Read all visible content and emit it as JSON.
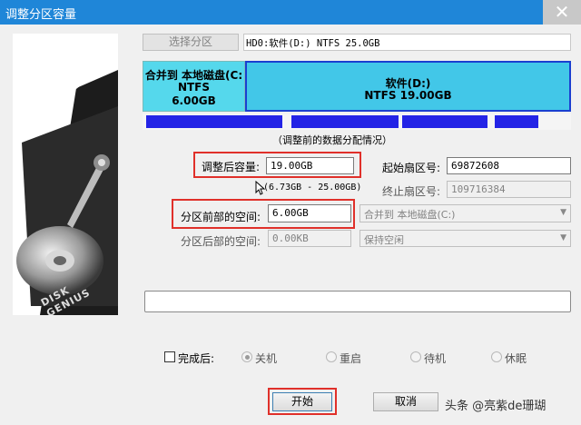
{
  "window": {
    "title": "调整分区容量",
    "close_glyph": "✕"
  },
  "top": {
    "select_partition_button": "选择分区",
    "disk_info": "HD0:软件(D:) NTFS 25.0GB"
  },
  "partitions": [
    {
      "line1": "合并到 本地磁盘(C:",
      "line2": "NTFS",
      "line3": "6.00GB",
      "fraction": 0.24,
      "color": "#55d8ec",
      "selected": false
    },
    {
      "line1": "软件(D:)",
      "line2": "NTFS 19.00GB",
      "line3": "",
      "fraction": 0.76,
      "color": "#42c7e8",
      "selected": true
    }
  ],
  "usage_caption": "（调整前的数据分配情况）",
  "fields": {
    "new_size_label": "调整后容量:",
    "new_size_value": "19.00GB",
    "range_hint": "(6.73GB - 25.00GB)",
    "start_sector_label": "起始扇区号:",
    "start_sector_value": "69872608",
    "end_sector_label": "终止扇区号:",
    "end_sector_value": "109716384",
    "space_before_label": "分区前部的空间:",
    "space_before_value": "6.00GB",
    "space_before_action": "合并到 本地磁盘(C:)",
    "space_after_label": "分区后部的空间:",
    "space_after_value": "0.00KB",
    "space_after_action": "保持空闲"
  },
  "after_completion": {
    "checkbox_label": "完成后:",
    "checked": false,
    "options": [
      "关机",
      "重启",
      "待机",
      "休眠"
    ],
    "selected_index": 0
  },
  "buttons": {
    "start": "开始",
    "cancel": "取消"
  },
  "left_image_text": "DISK GENIUS",
  "watermark": "头条 @亮紫de珊瑚"
}
